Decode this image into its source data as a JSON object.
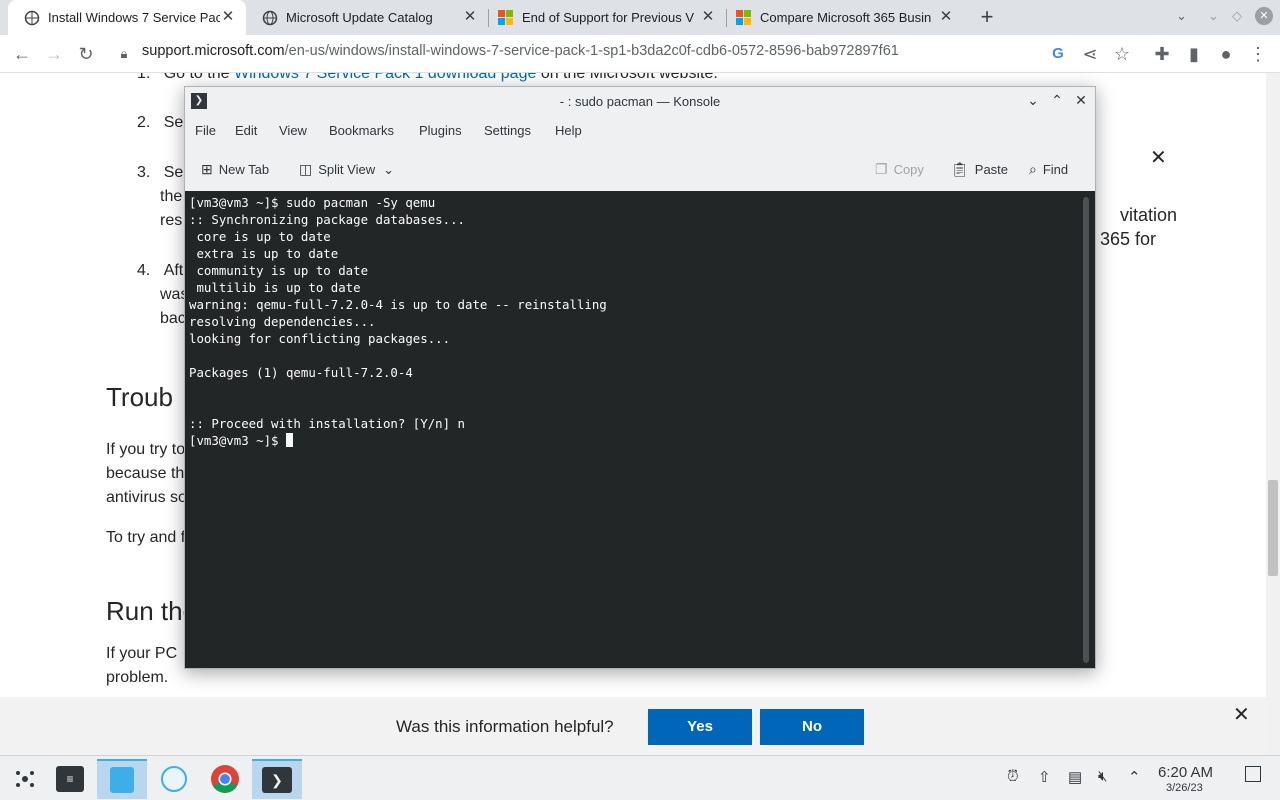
{
  "browser": {
    "tabs": [
      {
        "title": "Install Windows 7 Service Pac",
        "favicon": "windows-icon",
        "active": true
      },
      {
        "title": "Microsoft Update Catalog",
        "favicon": "globe-icon",
        "active": false
      },
      {
        "title": "End of Support for Previous V",
        "favicon": "microsoft-logo",
        "active": false
      },
      {
        "title": "Compare Microsoft 365 Busin",
        "favicon": "microsoft-logo",
        "active": false
      }
    ],
    "url_domain": "support.microsoft.com",
    "url_path": "/en-us/windows/install-windows-7-service-pack-1-sp1-b3da2c0f-cdb6-0572-8596-bab972897f61",
    "brand_colors": {
      "accent": "#0067b8",
      "ms_red": "#f25022",
      "ms_green": "#7fba00",
      "ms_blue": "#00a4ef",
      "ms_yellow": "#ffb900"
    }
  },
  "page": {
    "step1_prefix": "1.",
    "step1_text_a": "Go to the",
    "step1_link": "Windows 7 Service Pack 1 download page",
    "step1_text_b": "on the Microsoft website.",
    "step2_num": "2.",
    "step2_text": "Sel",
    "step3_num": "3.",
    "step3_line1": "Sel",
    "step3_line2": "the",
    "step3_line3": "res",
    "step4_num": "4.",
    "step4_line1": "Afte",
    "step4_line2": "was",
    "step4_line3": "bac",
    "right_frag1": "vitation",
    "right_frag2": "365 for",
    "h_troubleshoot": "Troub",
    "p1_line1": "If you try to",
    "p1_line2": "because th",
    "p1_line3": "antivirus so",
    "p2_line1": "To try and f",
    "h_run": "Run the",
    "p3_line1": "If your PC",
    "p3_line2": "problem."
  },
  "feedback": {
    "question": "Was this information helpful?",
    "yes": "Yes",
    "no": "No"
  },
  "konsole": {
    "title": "- : sudo pacman — Konsole",
    "menu": [
      "File",
      "Edit",
      "View",
      "Bookmarks",
      "Plugins",
      "Settings",
      "Help"
    ],
    "toolbar": {
      "new_tab": "New Tab",
      "split_view": "Split View",
      "copy": "Copy",
      "paste": "Paste",
      "find": "Find"
    },
    "terminal_lines": [
      "[vm3@vm3 ~]$ sudo pacman -Sy qemu",
      ":: Synchronizing package databases...",
      " core is up to date",
      " extra is up to date",
      " community is up to date",
      " multilib is up to date",
      "warning: qemu-full-7.2.0-4 is up to date -- reinstalling",
      "resolving dependencies...",
      "looking for conflicting packages...",
      "",
      "Packages (1) qemu-full-7.2.0-4",
      "",
      "",
      ":: Proceed with installation? [Y/n] n"
    ],
    "prompt": "[vm3@vm3 ~]$ "
  },
  "taskbar": {
    "time": "6:20 AM",
    "date": "3/26/23"
  }
}
